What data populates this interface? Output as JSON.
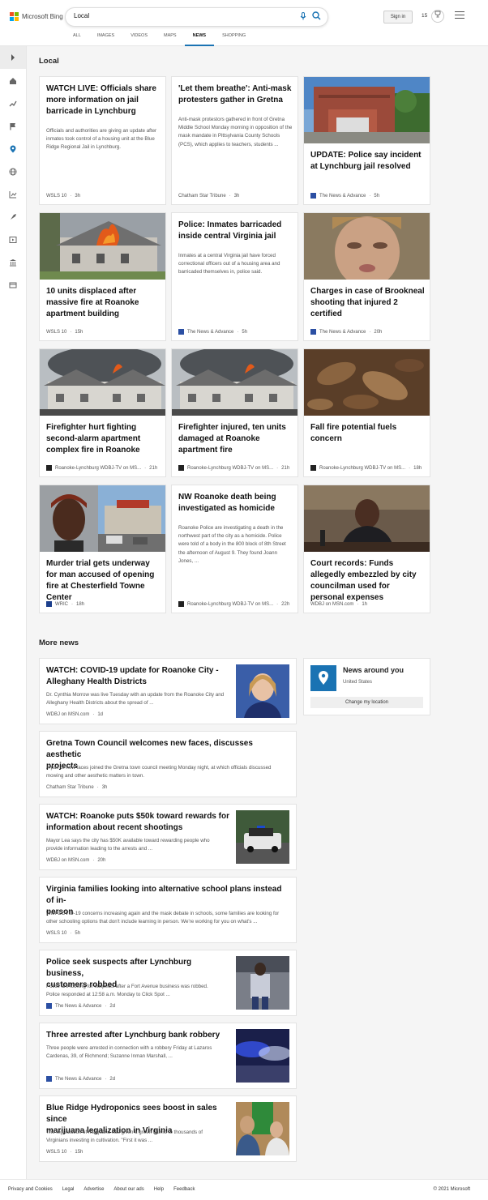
{
  "header": {
    "brand": "Microsoft Bing",
    "logo_colors": [
      "#f25022",
      "#7fba00",
      "#00a4ef",
      "#ffb900"
    ],
    "search_value": "Local",
    "signin_label": "Sign in",
    "rewards_points": "15",
    "tabs": [
      {
        "label": "ALL"
      },
      {
        "label": "IMAGES"
      },
      {
        "label": "VIDEOS"
      },
      {
        "label": "MAPS"
      },
      {
        "label": "NEWS"
      },
      {
        "label": "SHOPPING"
      }
    ],
    "active_tab": "NEWS"
  },
  "sidebar": {
    "icons": [
      "expand-icon",
      "home-icon",
      "trending-icon",
      "flag-icon",
      "location-icon",
      "globe-icon",
      "finance-icon",
      "science-icon",
      "entertainment-icon",
      "politics-icon",
      "more-icon"
    ],
    "active_icon": "location-icon"
  },
  "local": {
    "title": "Local",
    "cards": [
      {
        "title": "WATCH LIVE: Officials share more information on jail barricade in Lynchburg",
        "snippet": "Officials and authorities are giving an update after inmates took control of a housing unit at the Blue Ridge Regional Jail in Lynchburg.",
        "provider": "WSLS 10",
        "time": "3h"
      },
      {
        "title": "'Let them breathe': Anti-mask protesters gather in Gretna",
        "snippet": "Anti-mask protestors gathered in front of Gretna Middle School Monday morning in opposition of the mask mandate in Pittsylvania County Schools (PCS), which applies to teachers, students ...",
        "provider": "Chatham Star Tribune",
        "time": "3h"
      },
      {
        "title": "UPDATE: Police say incident at Lynchburg jail resolved",
        "provider": "The News & Advance",
        "time": "5h"
      },
      {
        "title": "10 units displaced after massive fire at Roanoke apartment building",
        "provider": "WSLS 10",
        "time": "15h"
      },
      {
        "title": "Police: Inmates barricaded inside central Virginia jail",
        "snippet": "Inmates at a central Virginia jail have forced correctional officers out of a housing area and barricaded themselves in, police said.",
        "provider": "The News & Advance",
        "time": "5h"
      },
      {
        "title": "Charges in case of Brookneal shooting that injured 2 certified",
        "provider": "The News & Advance",
        "time": "20h"
      },
      {
        "title": "Firefighter hurt fighting second-alarm apartment complex fire in Roanoke",
        "provider": "Roanoke-Lynchburg WDBJ-TV on MS...",
        "time": "21h"
      },
      {
        "title": "Firefighter injured, ten units damaged at Roanoke apartment fire",
        "provider": "Roanoke-Lynchburg WDBJ-TV on MS...",
        "time": "21h"
      },
      {
        "title": "Fall fire potential fuels concern",
        "provider": "Roanoke-Lynchburg WDBJ-TV on MS...",
        "time": "18h"
      },
      {
        "title": "Murder trial gets underway for man accused of opening fire at Chesterfield Towne Center",
        "provider": "WRIC",
        "time": "18h"
      },
      {
        "title": "NW Roanoke death being investigated as homicide",
        "snippet": "Roanoke Police are investigating a death in the northwest part of the city as a homicide. Police were told of a body in the 800 block of 8th Street the afternoon of August 9. They found Joann Jones, ...",
        "provider": "Roanoke-Lynchburg WDBJ-TV on MS...",
        "time": "22h"
      },
      {
        "title": "Court records: Funds allegedly embezzled by city councilman used for personal expenses",
        "provider": "WDBJ on MSN.com",
        "time": "1h"
      }
    ]
  },
  "more_news": {
    "title": "More news",
    "items": [
      {
        "title": "WATCH: COVID-19 update for Roanoke City -\nAlleghany Health Districts",
        "snippet": "Dr. Cynthia Morrow was live Tuesday with an update from the Roanoke City and\nAlleghany Health Districts about the spread of ...",
        "provider": "WDBJ on MSN.com",
        "time": "1d"
      },
      {
        "title": "Gretna Town Council welcomes new faces, discusses aesthetic\nprojects",
        "snippet": "A pair of new faces joined the Gretna town council meeting Monday night, at which officials discussed\nmowing and other aesthetic matters in town.",
        "provider": "Chatham Star Tribune",
        "time": "3h"
      },
      {
        "title": "WATCH: Roanoke puts $50k toward rewards for\ninformation about recent shootings",
        "snippet": "Mayor Lea says the city has $50K available toward rewarding people who\nprovide information leading to the arrests and ...",
        "provider": "WDBJ on MSN.com",
        "time": "20h"
      },
      {
        "title": "Virginia families looking into alternative school plans instead of in-\nperson",
        "snippet": "With COVID-19 concerns increasing again and the mask debate in schools, some families are looking for\nother schooling options that don't include learning in person. We're working for you on what's ...",
        "provider": "WSLS 10",
        "time": "5h"
      },
      {
        "title": "Police seek suspects after Lynchburg business,\ncustomers robbed",
        "snippet": "Police are looking for suspects after a Fort Avenue business was robbed.\nPolice responded at 12:58 a.m. Monday to Click Spot ...",
        "provider": "The News & Advance",
        "time": "2d"
      },
      {
        "title": "Three arrested after Lynchburg bank robbery",
        "snippet": "Three people were arrested in connection with a robbery Friday at Lazaros\nCardenas, 39, of Richmond; Suzanne Inman Marshall, ...",
        "provider": "The News & Advance",
        "time": "2d"
      },
      {
        "title": "Blue Ridge Hydroponics sees boost in sales since\nmarijuana legalization in Virginia",
        "snippet": "The legalization of marijuana has given a green thumb to thousands of\nVirginians investing in cultivation. \"First it was ...",
        "provider": "WSLS 10",
        "time": "15h"
      }
    ]
  },
  "news_around_you": {
    "title": "News around you",
    "location": "United States",
    "button": "Change my location"
  },
  "footer": {
    "links": [
      "Privacy and Cookies",
      "Legal",
      "Advertise",
      "About our ads",
      "Help",
      "Feedback"
    ],
    "copyright": "© 2021 Microsoft"
  }
}
